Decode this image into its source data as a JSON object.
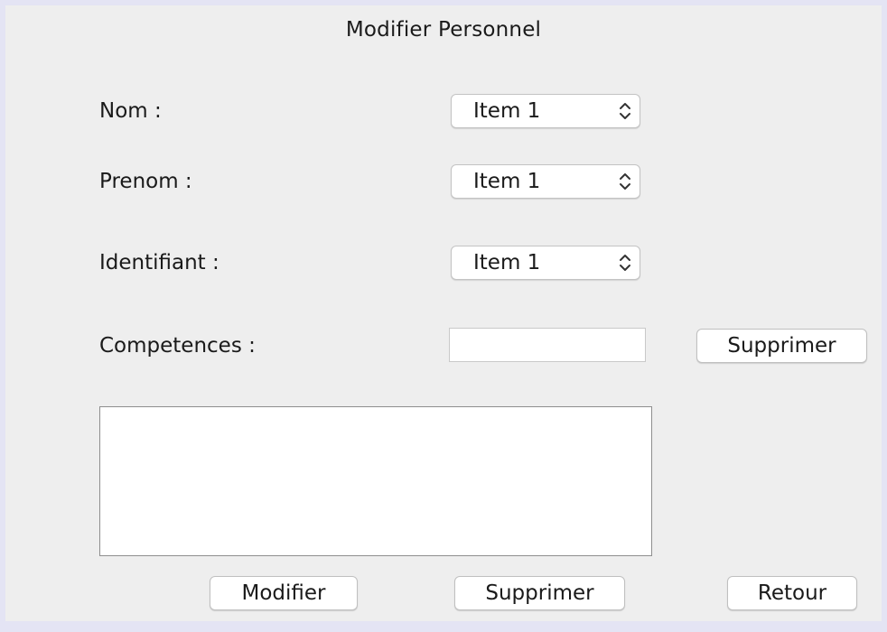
{
  "window": {
    "title": "Modifier Personnel"
  },
  "form": {
    "nom_label": "Nom :",
    "nom_value": "Item 1",
    "prenom_label": "Prenom :",
    "prenom_value": "Item 1",
    "identifiant_label": "Identifiant :",
    "identifiant_value": "Item 1",
    "competences_label": "Competences :",
    "competences_value": "",
    "competences_delete_label": "Supprimer",
    "details_text": ""
  },
  "actions": {
    "modifier_label": "Modifier",
    "supprimer_label": "Supprimer",
    "retour_label": "Retour"
  },
  "icons": {
    "combo_arrows": "up-down-chevron-icon"
  },
  "colors": {
    "window_background": "#eeeeee",
    "frame_border": "#e4e4f4",
    "control_background": "#ffffff"
  }
}
